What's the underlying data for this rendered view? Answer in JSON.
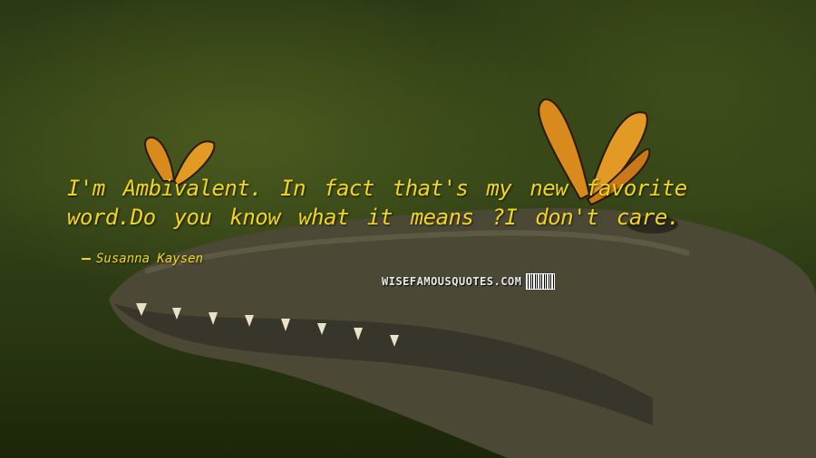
{
  "quote": {
    "text": "I'm Ambivalent. In fact that's my new favorite word.Do you know what it means ?I don't care.",
    "author": "Susanna Kaysen"
  },
  "watermark": {
    "text": "WISEFAMOUSQUOTES.COM"
  },
  "colors": {
    "quote_text": "#f2d51c",
    "background": "#2c3a14",
    "crocodile": "#4a4a3a",
    "butterfly": "#d88a1c"
  }
}
